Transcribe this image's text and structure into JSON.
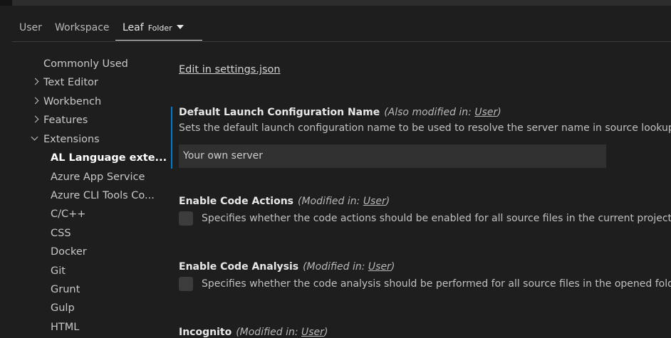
{
  "tabs": [
    {
      "label": "User"
    },
    {
      "label": "Workspace"
    },
    {
      "label": "Leaf",
      "sub": "Folder"
    }
  ],
  "tree": [
    {
      "label": "Commonly Used"
    },
    {
      "label": "Text Editor"
    },
    {
      "label": "Workbench"
    },
    {
      "label": "Features"
    },
    {
      "label": "Extensions"
    },
    {
      "label": "AL Language exte..."
    },
    {
      "label": "Azure App Service"
    },
    {
      "label": "Azure CLI Tools Co..."
    },
    {
      "label": "C/C++"
    },
    {
      "label": "CSS"
    },
    {
      "label": "Docker"
    },
    {
      "label": "Git"
    },
    {
      "label": "Grunt"
    },
    {
      "label": "Gulp"
    },
    {
      "label": "HTML"
    }
  ],
  "content": {
    "edit_link": "Edit in settings.json",
    "settings": [
      {
        "title": "Default Launch Configuration Name",
        "modified_prefix": "(Also modified in: ",
        "modified_link": "User",
        "modified_suffix": ")",
        "description": "Sets the default launch configuration name to be used to resolve the server name in source lookup se",
        "value": "Your own server"
      },
      {
        "title": "Enable Code Actions",
        "modified_prefix": "(Modified in: ",
        "modified_link": "User",
        "modified_suffix": ")",
        "description": "Specifies whether the code actions should be enabled for all source files in the current project."
      },
      {
        "title": "Enable Code Analysis",
        "modified_prefix": "(Modified in: ",
        "modified_link": "User",
        "modified_suffix": ")",
        "description": "Specifies whether the code analysis should be performed for all source files in the opened folder"
      },
      {
        "title": "Incognito",
        "modified_prefix": "(Modified in: ",
        "modified_link": "User",
        "modified_suffix": ")"
      }
    ]
  }
}
